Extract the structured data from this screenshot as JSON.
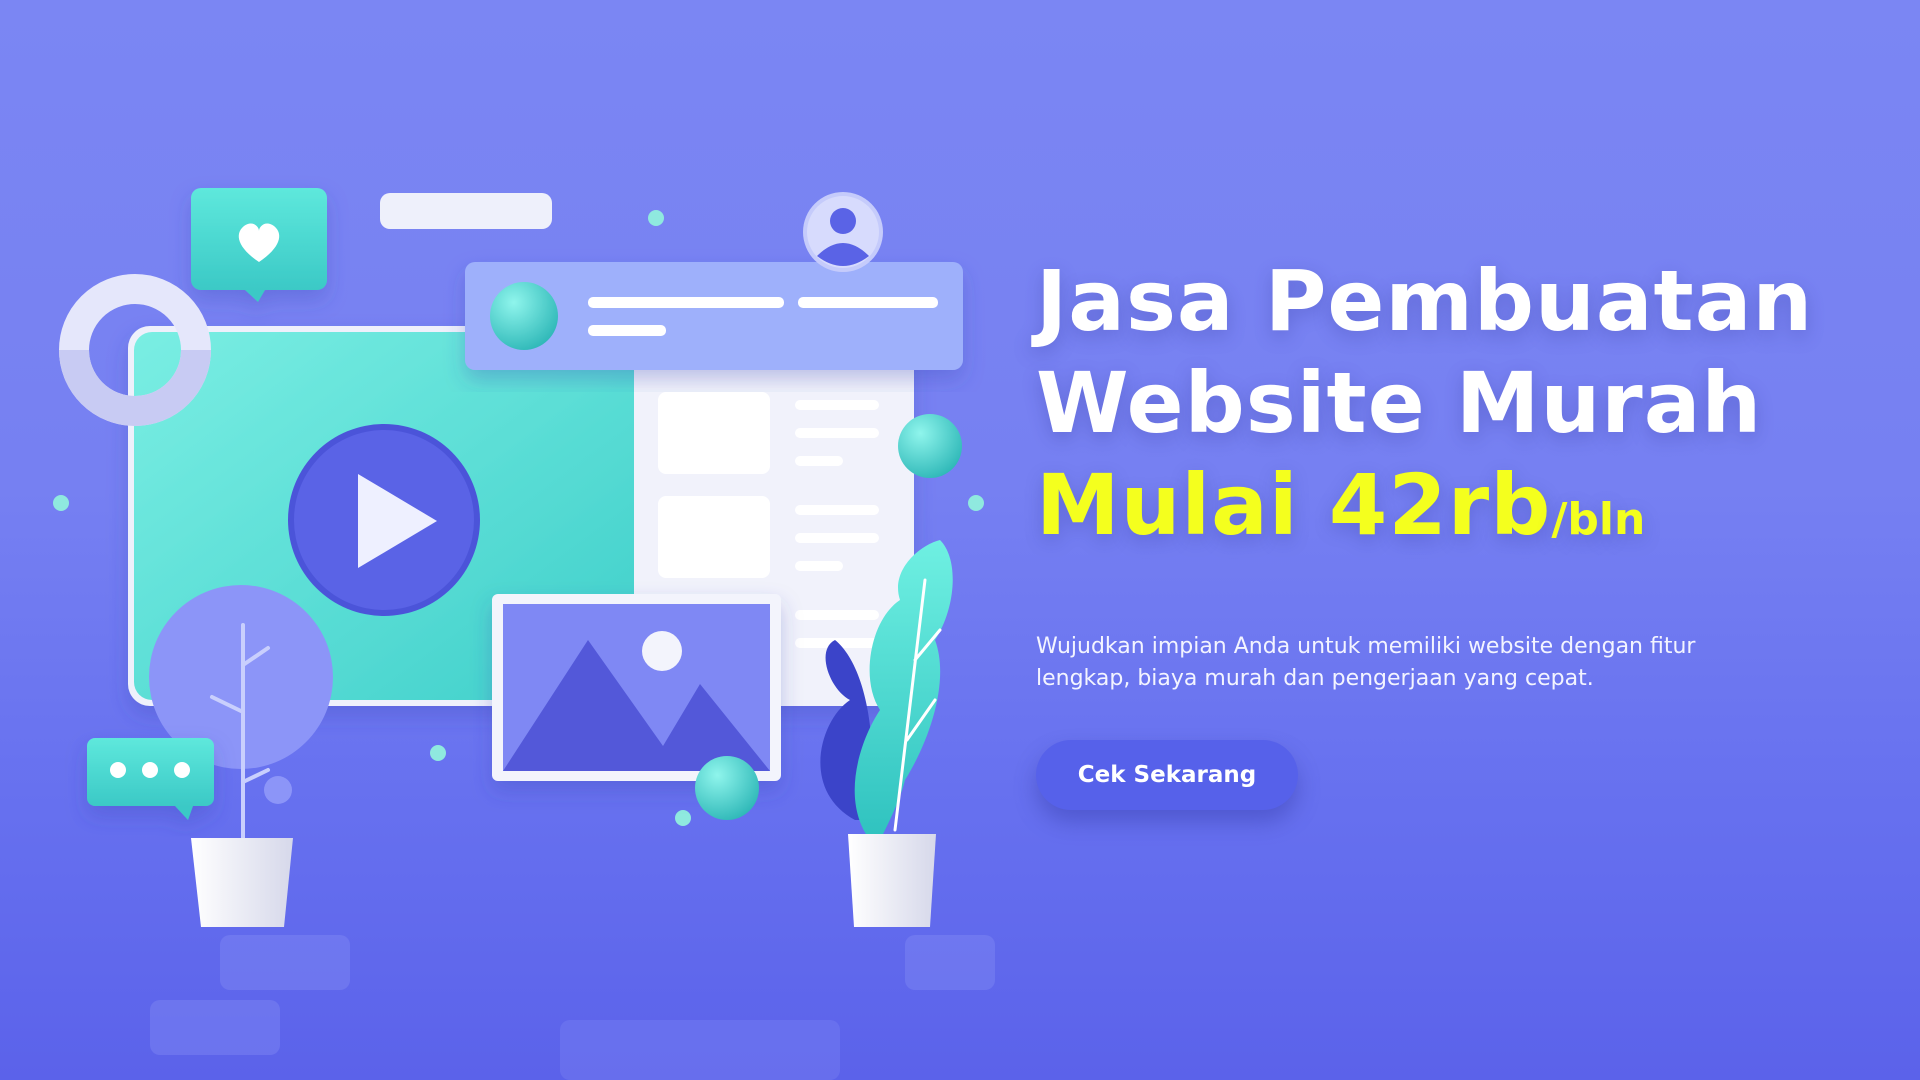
{
  "hero": {
    "headline_line1": "Jasa Pembuatan",
    "headline_line2": "Website Murah",
    "headline_price": "Mulai 42rb",
    "headline_per_month": "/bln",
    "description": "Wujudkan impian Anda untuk memiliki website dengan fitur lengkap, biaya murah dan pengerjaan yang cepat.",
    "cta_label": "Cek Sekarang"
  },
  "colors": {
    "background": "#7680f2",
    "price_highlight": "#f4ff1e",
    "button": "#5661ea",
    "accent_teal": "#4fe0d3"
  },
  "illustration": {
    "icons": [
      "heart-chat-bubble-icon",
      "user-avatar-icon",
      "play-icon",
      "image-icon",
      "typing-chat-bubble-icon"
    ]
  }
}
